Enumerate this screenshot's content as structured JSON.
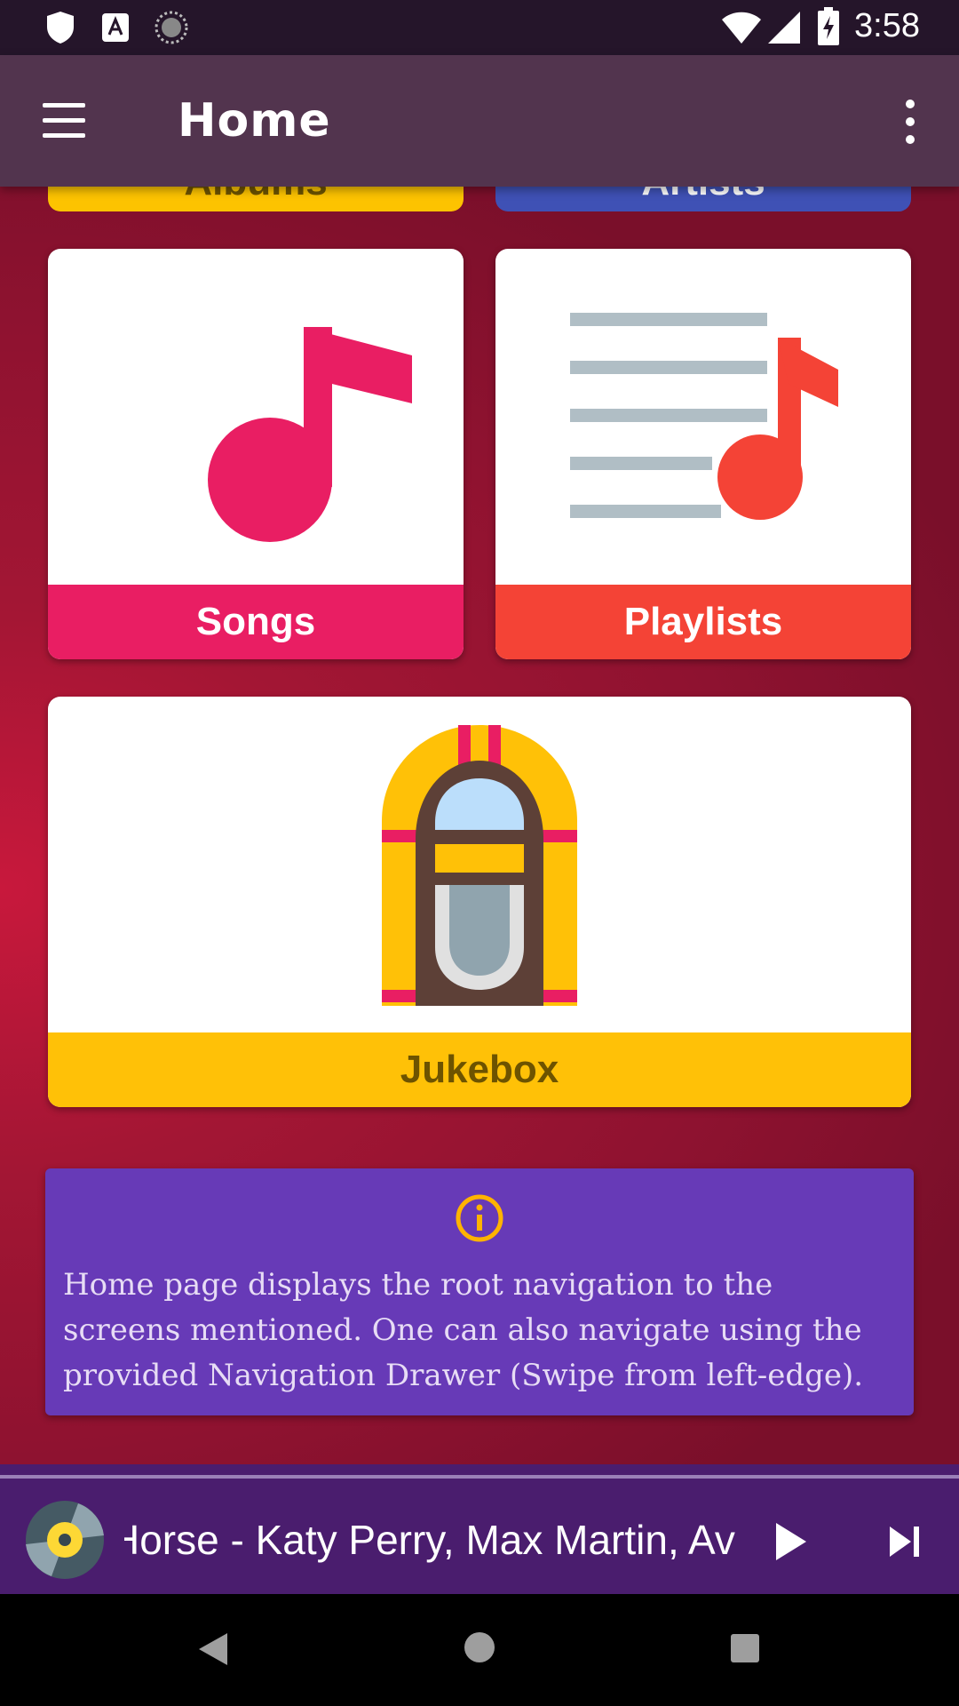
{
  "status_bar": {
    "time": "3:58",
    "icons": [
      "shield-icon",
      "a11y-font-icon",
      "sync-icon",
      "wifi-icon",
      "cell-signal-icon",
      "battery-charging-icon"
    ]
  },
  "app_bar": {
    "title": "Home",
    "menu_icon": "hamburger-menu-icon",
    "overflow_icon": "more-vert-icon"
  },
  "tiles": {
    "albums": {
      "label": "Albums",
      "color": "#fdc300"
    },
    "artists": {
      "label": "Artists",
      "color": "#3f51b5"
    },
    "songs": {
      "label": "Songs",
      "color": "#e91e63",
      "icon": "music-note-icon"
    },
    "playlists": {
      "label": "Playlists",
      "color": "#f44336",
      "icon": "playlist-icon"
    },
    "jukebox": {
      "label": "Jukebox",
      "color": "#ffc107",
      "label_color": "#6d5300",
      "icon": "jukebox-icon"
    }
  },
  "info": {
    "icon": "info-icon",
    "text": "Home page displays the root navigation to the screens mentioned. One can also navigate using the provided Navigation Drawer (Swipe from left-edge)."
  },
  "now_playing": {
    "track": "Horse - Katy Perry, Max Martin, Av",
    "icons": [
      "album-art-disc-icon",
      "play-icon",
      "skip-next-icon"
    ]
  },
  "system_nav": {
    "icons": [
      "back-icon",
      "home-icon",
      "recents-icon"
    ]
  }
}
